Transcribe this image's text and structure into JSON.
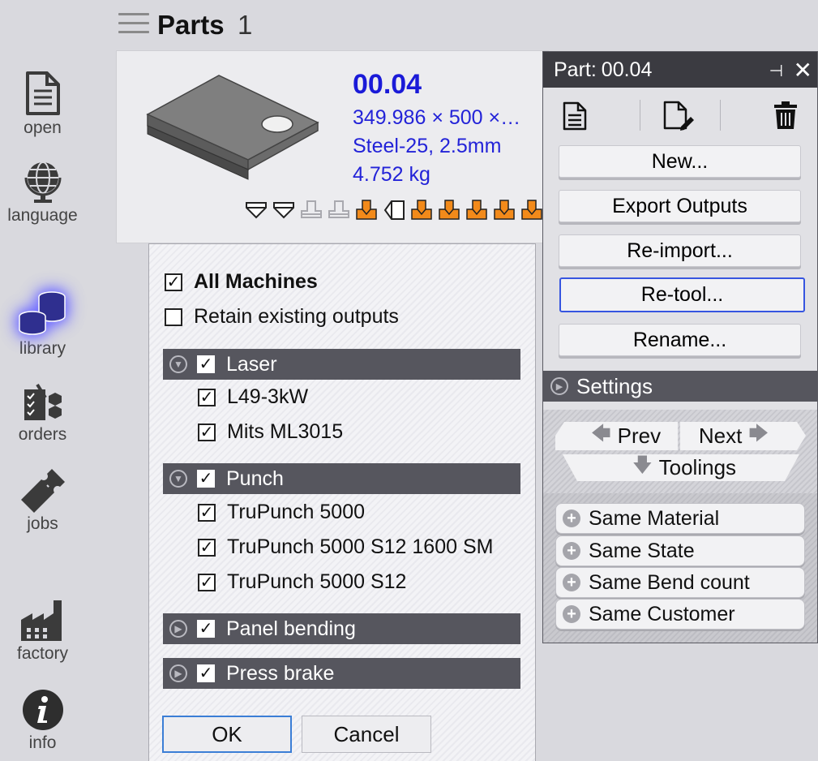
{
  "sidebar": {
    "items": [
      {
        "label": "open",
        "icon": "document-icon"
      },
      {
        "label": "language",
        "icon": "globe-icon"
      },
      {
        "label": "library",
        "icon": "library-stack-icon",
        "active": true
      },
      {
        "label": "orders",
        "icon": "orders-icon"
      },
      {
        "label": "jobs",
        "icon": "ticket-icon"
      },
      {
        "label": "factory",
        "icon": "factory-icon"
      },
      {
        "label": "info",
        "icon": "info-icon"
      }
    ]
  },
  "header": {
    "title": "Parts",
    "count": "1"
  },
  "part": {
    "id": "00.04",
    "dimensions": "349.986 × 500 ×…",
    "material": "Steel-25, 2.5mm",
    "weight": "4.752 kg",
    "tooling_icons": [
      "outline",
      "outline",
      "disabled",
      "disabled",
      "orange",
      "outline-left",
      "orange",
      "orange",
      "orange",
      "orange",
      "orange"
    ]
  },
  "machine_selection": {
    "all_machines": {
      "label": "All Machines",
      "checked": true
    },
    "retain_outputs": {
      "label": "Retain existing outputs",
      "checked": false
    },
    "groups": [
      {
        "name": "Laser",
        "checked": true,
        "expanded": true,
        "machines": [
          {
            "name": "L49-3kW",
            "checked": true
          },
          {
            "name": "Mits ML3015",
            "checked": true
          }
        ]
      },
      {
        "name": "Punch",
        "checked": true,
        "expanded": true,
        "machines": [
          {
            "name": "TruPunch 5000",
            "checked": true
          },
          {
            "name": "TruPunch 5000 S12 1600 SM",
            "checked": true
          },
          {
            "name": "TruPunch 5000 S12",
            "checked": true
          }
        ]
      },
      {
        "name": "Panel bending",
        "checked": true,
        "expanded": false,
        "machines": []
      },
      {
        "name": "Press brake",
        "checked": true,
        "expanded": false,
        "machines": []
      }
    ],
    "ok_label": "OK",
    "cancel_label": "Cancel"
  },
  "panel": {
    "title_prefix": "Part:",
    "title_value": "00.04",
    "buttons": {
      "new": "New...",
      "export": "Export Outputs",
      "reimport": "Re-import...",
      "retool": "Re-tool...",
      "rename": "Rename..."
    },
    "settings_label": "Settings",
    "prev_label": "Prev",
    "next_label": "Next",
    "toolings_label": "Toolings",
    "filters": [
      "Same Material",
      "Same State",
      "Same Bend count",
      "Same Customer"
    ]
  },
  "colors": {
    "accent_blue": "#1a1ad8",
    "tool_orange": "#f28a1a",
    "bar_dark": "#56565e",
    "title_dark": "#3b3b41",
    "library_glow": "#6a66ff"
  }
}
